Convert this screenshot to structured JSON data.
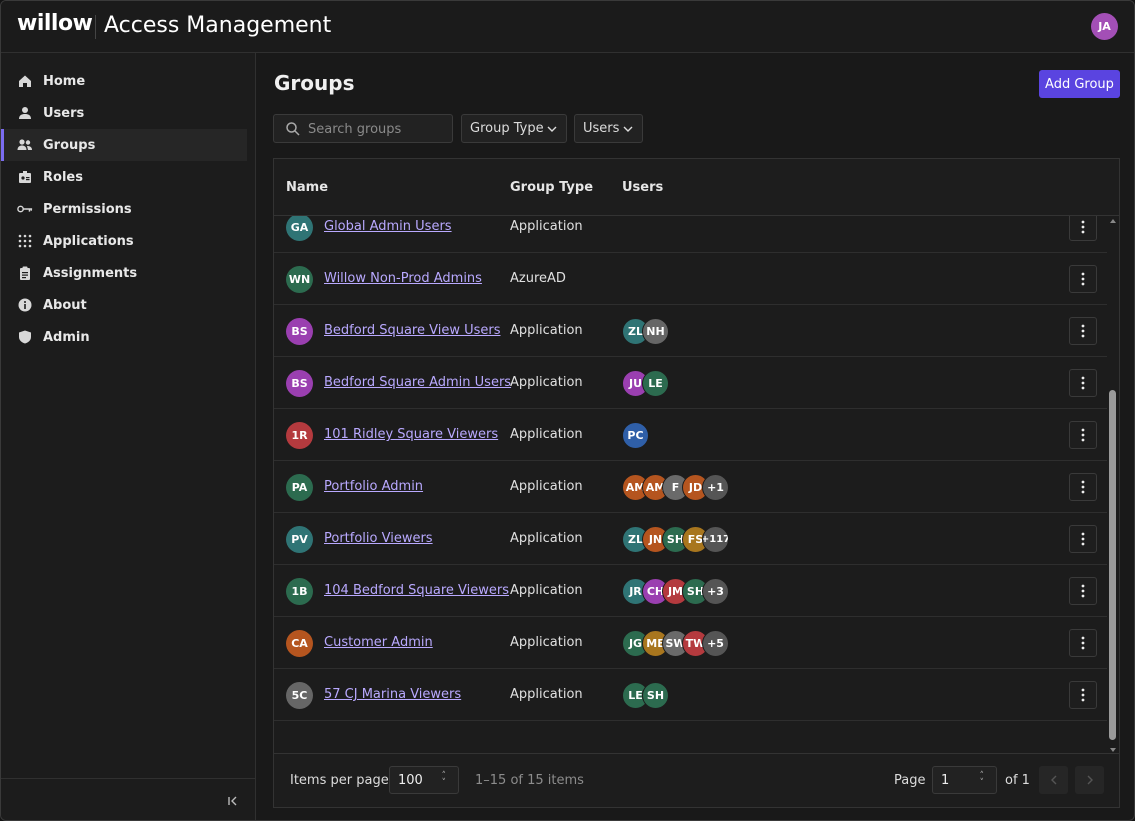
{
  "app": {
    "logo": "willow",
    "title": "Access Management",
    "user_initials": "JA",
    "user_color": "#a34fb6"
  },
  "sidebar": {
    "items": [
      {
        "label": "Home",
        "icon": "home-icon"
      },
      {
        "label": "Users",
        "icon": "user-icon"
      },
      {
        "label": "Groups",
        "icon": "groups-icon",
        "active": true
      },
      {
        "label": "Roles",
        "icon": "badge-icon"
      },
      {
        "label": "Permissions",
        "icon": "key-icon"
      },
      {
        "label": "Applications",
        "icon": "grid-icon"
      },
      {
        "label": "Assignments",
        "icon": "clipboard-icon"
      },
      {
        "label": "About",
        "icon": "info-icon"
      },
      {
        "label": "Admin",
        "icon": "shield-icon"
      }
    ],
    "collapse_icon": "collapse-sidebar-icon"
  },
  "main": {
    "title": "Groups",
    "add_button": "Add Group",
    "accent": "#5a44e0",
    "search_placeholder": "Search groups",
    "filters": [
      "Group Type",
      "Users"
    ]
  },
  "table": {
    "columns": [
      "Name",
      "Group Type",
      "Users"
    ],
    "rows": [
      {
        "initials": "GA",
        "color": "#2f7475",
        "name": "Global Admin Users",
        "type": "Application",
        "users": []
      },
      {
        "initials": "WN",
        "color": "#2c6b4f",
        "name": "Willow Non-Prod Admins",
        "type": "AzureAD",
        "users": []
      },
      {
        "initials": "BS",
        "color": "#9a3fb0",
        "name": "Bedford Square View Users",
        "type": "Application",
        "users": [
          {
            "i": "ZL",
            "c": "#2f7475"
          },
          {
            "i": "NH",
            "c": "#666666"
          }
        ]
      },
      {
        "initials": "BS",
        "color": "#9a3fb0",
        "name": "Bedford Square Admin Users",
        "type": "Application",
        "users": [
          {
            "i": "JU",
            "c": "#9a3fb0"
          },
          {
            "i": "LE",
            "c": "#2c6b4f"
          }
        ]
      },
      {
        "initials": "1R",
        "color": "#b43a3e",
        "name": "101 Ridley Square Viewers",
        "type": "Application",
        "users": [
          {
            "i": "PC",
            "c": "#2f5fa8"
          }
        ]
      },
      {
        "initials": "PA",
        "color": "#2c6b4f",
        "name": "Portfolio Admin",
        "type": "Application",
        "users": [
          {
            "i": "AM",
            "c": "#b5551f"
          },
          {
            "i": "AM",
            "c": "#b5551f"
          },
          {
            "i": "F",
            "c": "#6a6a6a"
          },
          {
            "i": "JD",
            "c": "#b5551f"
          },
          {
            "i": "+1",
            "c": "#555555"
          }
        ]
      },
      {
        "initials": "PV",
        "color": "#2f7475",
        "name": "Portfolio Viewers",
        "type": "Application",
        "users": [
          {
            "i": "ZL",
            "c": "#2f7475"
          },
          {
            "i": "JN",
            "c": "#b5551f"
          },
          {
            "i": "SH",
            "c": "#2c6b4f"
          },
          {
            "i": "FS",
            "c": "#a8761e"
          },
          {
            "i": "+117",
            "c": "#555555"
          }
        ]
      },
      {
        "initials": "1B",
        "color": "#2c6b4f",
        "name": "104 Bedford Square Viewers",
        "type": "Application",
        "users": [
          {
            "i": "JR",
            "c": "#2f7475"
          },
          {
            "i": "CH",
            "c": "#9a3fb0"
          },
          {
            "i": "JM",
            "c": "#b43a3e"
          },
          {
            "i": "SH",
            "c": "#2c6b4f"
          },
          {
            "i": "+3",
            "c": "#555555"
          }
        ]
      },
      {
        "initials": "CA",
        "color": "#b5551f",
        "name": "Customer Admin",
        "type": "Application",
        "users": [
          {
            "i": "JG",
            "c": "#2c6b4f"
          },
          {
            "i": "ME",
            "c": "#a8761e"
          },
          {
            "i": "SW",
            "c": "#6a6a6a"
          },
          {
            "i": "TW",
            "c": "#b43a3e"
          },
          {
            "i": "+5",
            "c": "#555555"
          }
        ]
      },
      {
        "initials": "5C",
        "color": "#666666",
        "name": "57 CJ Marina Viewers",
        "type": "Application",
        "users": [
          {
            "i": "LE",
            "c": "#2c6b4f"
          },
          {
            "i": "SH",
            "c": "#2c6b4f"
          }
        ]
      }
    ],
    "partial_top_row": {
      "color": "#2f5fa8",
      "user_color": "#2c6b4f"
    }
  },
  "pagination": {
    "items_per_page_label": "Items per page",
    "items_per_page": "100",
    "range": "1–15 of 15 items",
    "page_label": "Page",
    "page": "1",
    "of_label": "of 1"
  }
}
